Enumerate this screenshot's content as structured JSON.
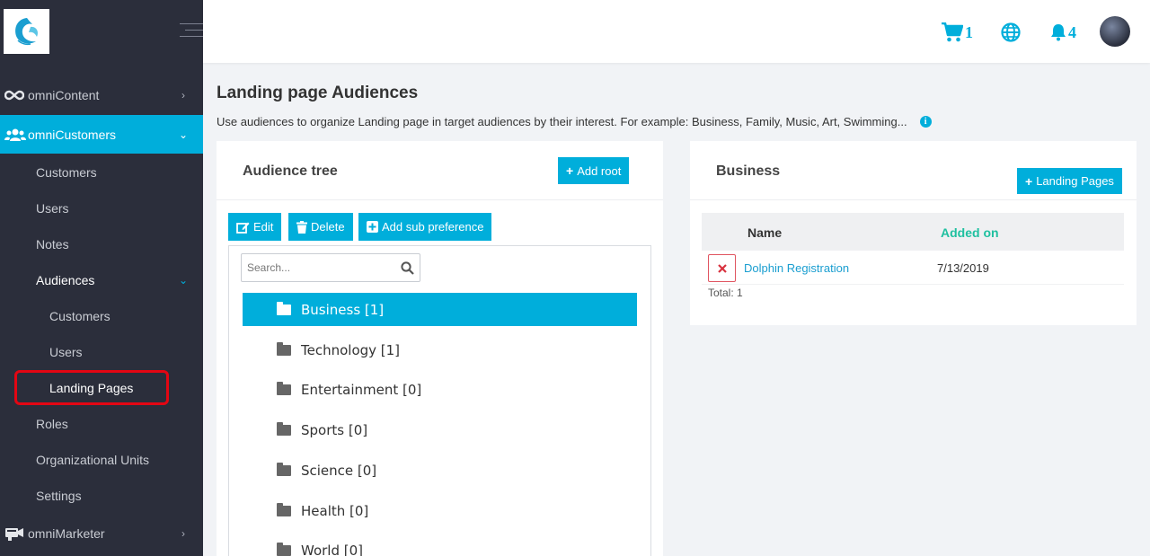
{
  "sidebar": {
    "items": [
      {
        "label": "omniContent"
      },
      {
        "label": "omniCustomers"
      },
      {
        "label": "Customers"
      },
      {
        "label": "Users"
      },
      {
        "label": "Notes"
      },
      {
        "label": "Audiences"
      },
      {
        "label": "Customers"
      },
      {
        "label": "Users"
      },
      {
        "label": "Landing Pages"
      },
      {
        "label": "Roles"
      },
      {
        "label": "Organizational Units"
      },
      {
        "label": "Settings"
      },
      {
        "label": "omniMarketer"
      }
    ]
  },
  "topbar": {
    "cart_count": "1",
    "notification_count": "4"
  },
  "page": {
    "title": "Landing page Audiences",
    "description": "Use audiences to organize Landing page in target audiences by their interest. For example: Business, Family, Music, Art, Swimming...",
    "info_glyph": "i"
  },
  "tree_panel": {
    "title": "Audience tree",
    "add_root": "Add root",
    "edit": "Edit",
    "delete": "Delete",
    "add_sub": "Add sub preference",
    "search_placeholder": "Search...",
    "nodes": [
      {
        "label": "Business [1]",
        "selected": true
      },
      {
        "label": "Technology [1]"
      },
      {
        "label": "Entertainment [0]"
      },
      {
        "label": "Sports [0]"
      },
      {
        "label": "Science [0]"
      },
      {
        "label": "Health [0]"
      },
      {
        "label": "World [0]"
      }
    ]
  },
  "detail_panel": {
    "title": "Business",
    "landing_pages_button": "Landing Pages",
    "columns": {
      "name": "Name",
      "added_on": "Added on"
    },
    "rows": [
      {
        "name": "Dolphin Registration",
        "added_on": "7/13/2019"
      }
    ],
    "total": "Total: 1"
  },
  "colors": {
    "accent": "#00aedb",
    "sidebar_bg": "#2b2e3b",
    "highlight": "#e30613",
    "added_on_header": "#1fc0a0"
  },
  "icons": [
    "logo-icon",
    "menu-icon",
    "infinity-icon",
    "users-icon",
    "chevron-right-icon",
    "chevron-down-icon",
    "marketer-icon",
    "cart-icon",
    "globe-icon",
    "bell-icon",
    "info-icon",
    "plus-icon",
    "edit-icon",
    "trash-icon",
    "plus-square-icon",
    "search-icon",
    "folder-icon",
    "close-icon"
  ]
}
